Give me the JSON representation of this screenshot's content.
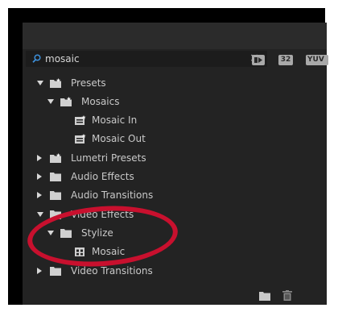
{
  "search": {
    "value": "mosaic",
    "placeholder": ""
  },
  "toolbar": {
    "accelerated_label": "",
    "bit32_label": "32",
    "yuv_label": "YUV"
  },
  "tree": {
    "presets": "Presets",
    "mosaics": "Mosaics",
    "mosaic_in": "Mosaic In",
    "mosaic_out": "Mosaic Out",
    "lumetri_presets": "Lumetri Presets",
    "audio_effects": "Audio Effects",
    "audio_transitions": "Audio Transitions",
    "video_effects": "Video Effects",
    "stylize": "Stylize",
    "mosaic": "Mosaic",
    "video_transitions": "Video Transitions"
  },
  "colors": {
    "panel_bg": "#232323",
    "text": "#c9c9c9",
    "annotation": "#c8102e"
  },
  "icons": {
    "search": "search-icon",
    "clear": "close-icon",
    "folder": "folder-icon",
    "preset_folder": "preset-folder-icon",
    "effect": "effect-icon",
    "new_bin": "new-bin-icon",
    "delete": "trash-icon"
  }
}
